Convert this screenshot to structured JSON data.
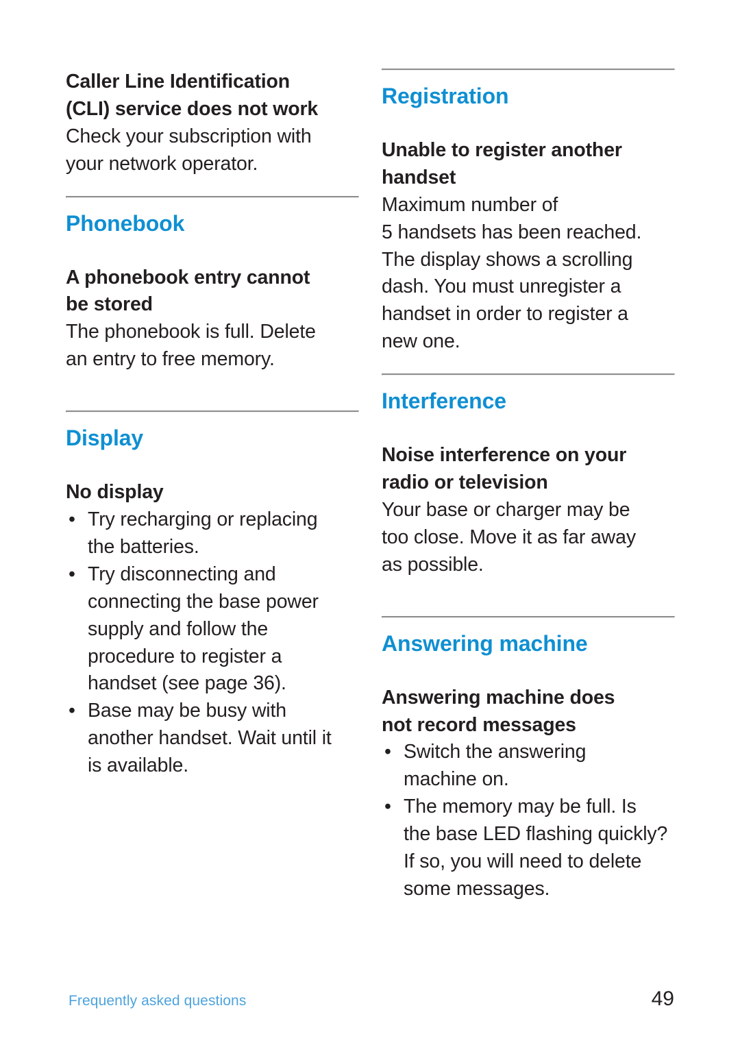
{
  "page": {
    "number": "49",
    "footer_label": "Frequently asked questions",
    "heading_color": "#0f8fd2",
    "footer_color": "#4da3dd",
    "text_color": "#231f20",
    "rule_color": "#8d8d8d"
  },
  "left_column": {
    "cli_block": {
      "sub_title_line1": "Caller Line Identification",
      "sub_title_line2": "(CLI) service does not work",
      "body_line1": "Check your subscription with",
      "body_line2": "your network operator."
    },
    "phonebook": {
      "section_title": "Phonebook",
      "sub_title_line1": "A phonebook entry cannot",
      "sub_title_line2": "be stored",
      "body_line1": "The phonebook is full. Delete",
      "body_line2": "an entry to free memory."
    },
    "display": {
      "section_title": "Display",
      "sub_title": "No display",
      "bullets": [
        {
          "marker": "•",
          "lines": [
            "Try recharging or replacing",
            "the batteries."
          ]
        },
        {
          "marker": "•",
          "lines": [
            "Try disconnecting and",
            "connecting the base power",
            "supply and follow the",
            "procedure to register a",
            "handset (see page 36)."
          ]
        },
        {
          "marker": "•",
          "lines": [
            "Base may be busy with",
            "another handset. Wait until it",
            "is available."
          ]
        }
      ]
    }
  },
  "right_column": {
    "registration": {
      "section_title": "Registration",
      "sub_title_line1": "Unable to register another",
      "sub_title_line2": "handset",
      "body_lines": [
        "Maximum number of",
        "5 handsets has been reached.",
        "The display shows a scrolling",
        "dash. You must unregister a",
        "handset in order to register a",
        "new one."
      ]
    },
    "interference": {
      "section_title": "Interference",
      "sub_title_line1": "Noise interference on your",
      "sub_title_line2": "radio or television",
      "body_lines": [
        "Your base or charger may be",
        "too close. Move it as far away",
        "as possible."
      ]
    },
    "answering_machine": {
      "section_title": "Answering machine",
      "sub_title_line1": "Answering machine does",
      "sub_title_line2": "not record messages",
      "bullets": [
        {
          "marker": "•",
          "lines": [
            "Switch the answering",
            "machine on."
          ]
        },
        {
          "marker": "•",
          "lines": [
            "The memory may be full. Is",
            "the base LED flashing quickly?",
            "If so, you will need to delete",
            "some messages."
          ]
        }
      ]
    }
  }
}
